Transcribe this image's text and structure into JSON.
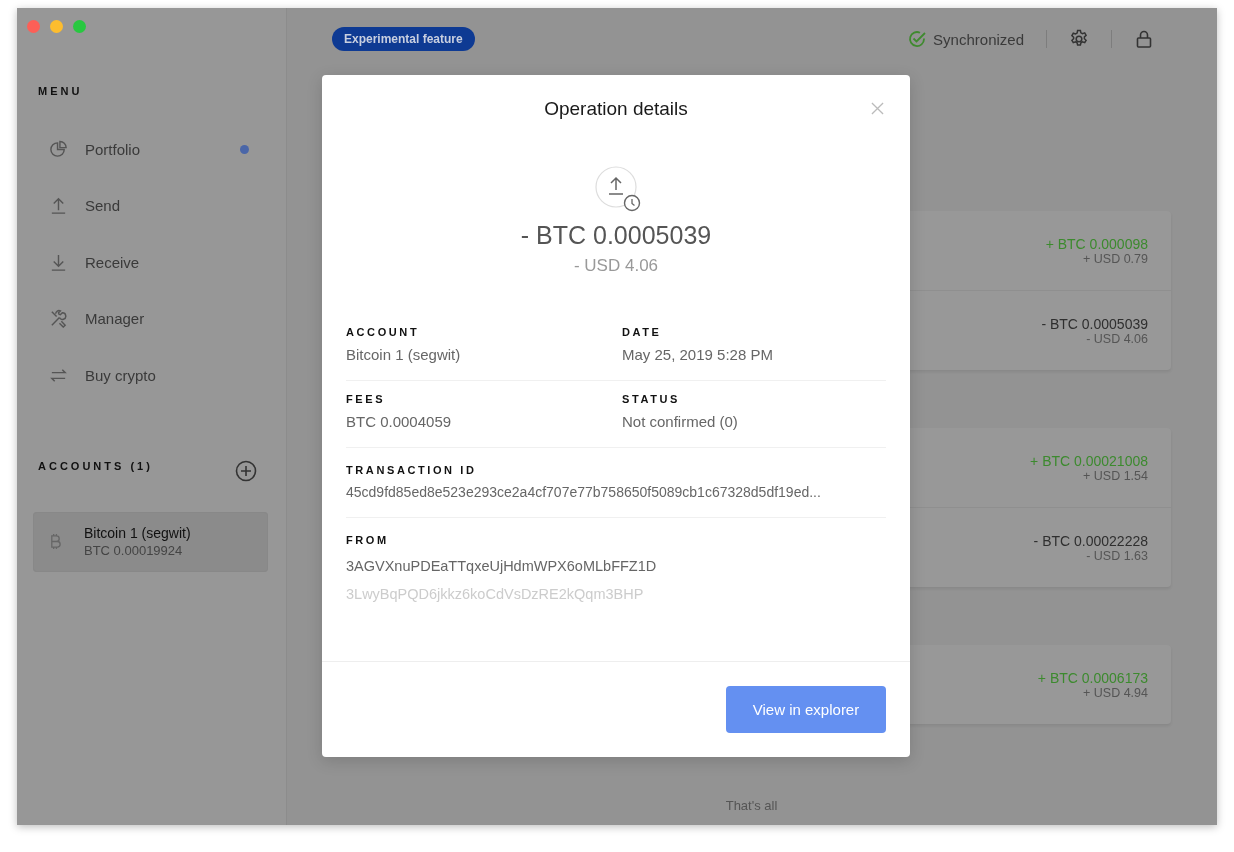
{
  "sidebar": {
    "menu_title": "MENU",
    "items": [
      {
        "kind": "portfolio",
        "label": "Portfolio",
        "notification": true
      },
      {
        "kind": "send",
        "label": "Send",
        "notification": false
      },
      {
        "kind": "receive",
        "label": "Receive",
        "notification": false
      },
      {
        "kind": "manager",
        "label": "Manager",
        "notification": false
      },
      {
        "kind": "buy",
        "label": "Buy crypto",
        "notification": false
      }
    ],
    "accounts_title": "ACCOUNTS (1)",
    "accounts": [
      {
        "name": "Bitcoin 1 (segwit)",
        "balance": "BTC 0.00019924",
        "selected": true
      }
    ]
  },
  "top_bar": {
    "badge": "Experimental feature",
    "sync_status": "Synchronized"
  },
  "operation_groups": [
    {
      "operations": [
        {
          "kind": "incoming",
          "amount": "+ BTC 0.000098",
          "fiat": "+ USD 0.79"
        },
        {
          "kind": "outgoing",
          "amount": "- BTC 0.0005039",
          "fiat": "- USD 4.06"
        }
      ]
    },
    {
      "operations": [
        {
          "kind": "incoming",
          "amount": "+ BTC 0.00021008",
          "fiat": "+ USD 1.54"
        },
        {
          "kind": "outgoing",
          "amount": "- BTC 0.00022228",
          "fiat": "- USD 1.63"
        }
      ]
    },
    {
      "operations": [
        {
          "kind": "incoming",
          "amount": "+ BTC 0.0006173",
          "fiat": "+ USD 4.94"
        }
      ]
    }
  ],
  "footer_note": "That's all",
  "modal": {
    "title": "Operation details",
    "kind": "outgoing",
    "amount": "- BTC 0.0005039",
    "fiat": "- USD 4.06",
    "fields": [
      {
        "label": "ACCOUNT",
        "value": "Bitcoin 1 (segwit)"
      },
      {
        "label": "DATE",
        "value": "May 25, 2019 5:28 PM"
      },
      {
        "label": "FEES",
        "value": "BTC 0.0004059"
      },
      {
        "label": "STATUS",
        "value": "Not confirmed (0)"
      }
    ],
    "transaction_id_label": "TRANSACTION ID",
    "transaction_id": "45cd9fd85ed8e523e293ce2a4cf707e77b758650f5089cb1c67328d5df19ed...",
    "from_label": "FROM",
    "from": [
      "3AGVXnuPDEaTTqxeUjHdmWPX6oMLbFFZ1D",
      "3LwyBqPQD6jkkz6koCdVsDzRE2kQqm3BHP"
    ],
    "button": "View in explorer"
  }
}
